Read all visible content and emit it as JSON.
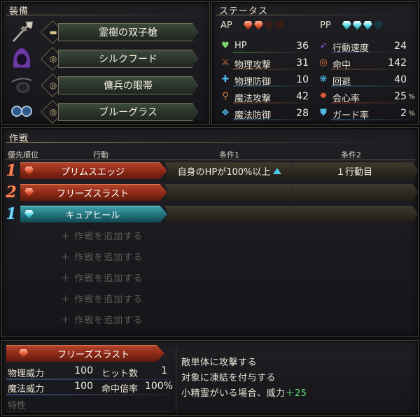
{
  "equipment": {
    "title": "装備",
    "items": [
      {
        "name": "霊樹の双子槍",
        "icon": "spear-icon",
        "slot_icon": "weapon-slot-icon"
      },
      {
        "name": "シルクフード",
        "icon": "hood-icon",
        "slot_icon": "ring-slot-icon"
      },
      {
        "name": "傭兵の眼帯",
        "icon": "eyepatch-icon",
        "slot_icon": "ring-slot-icon"
      },
      {
        "name": "ブルーグラス",
        "icon": "goggles-icon",
        "slot_icon": "ring-slot-icon"
      }
    ]
  },
  "status": {
    "title": "ステータス",
    "ap_label": "AP",
    "ap_filled": 2,
    "ap_total": 4,
    "pp_label": "PP",
    "pp_filled": 3,
    "pp_total": 4,
    "left": [
      {
        "label": "HP",
        "value": "36",
        "icon": "heart-icon",
        "color": "#7fd86a"
      },
      {
        "label": "物理攻撃",
        "value": "31",
        "icon": "sword-icon",
        "color": "#e07a3a"
      },
      {
        "label": "物理防御",
        "value": "10",
        "icon": "armor-icon",
        "color": "#4fb8e6"
      },
      {
        "label": "魔法攻撃",
        "value": "42",
        "icon": "staff-icon",
        "color": "#e0843a"
      },
      {
        "label": "魔法防御",
        "value": "28",
        "icon": "ward-icon",
        "color": "#4fb8e6"
      }
    ],
    "right": [
      {
        "label": "行動速度",
        "value": "24",
        "unit": "",
        "icon": "wing-icon",
        "color": "#8a5ad8"
      },
      {
        "label": "命中",
        "value": "142",
        "unit": "",
        "icon": "target-icon",
        "color": "#e07a3a"
      },
      {
        "label": "回避",
        "value": "40",
        "unit": "",
        "icon": "evade-icon",
        "color": "#4fb8e6"
      },
      {
        "label": "会心率",
        "value": "25",
        "unit": "%",
        "icon": "critical-icon",
        "color": "#e05a3a"
      },
      {
        "label": "ガード率",
        "value": "2",
        "unit": "%",
        "icon": "shield-icon",
        "color": "#4fb8e6"
      }
    ]
  },
  "tactics": {
    "title": "作戦",
    "headers": {
      "priority": "優先順位",
      "action": "行動",
      "cond1": "条件1",
      "cond2": "条件2"
    },
    "rows": [
      {
        "priority": "1",
        "priority_color": "red",
        "action": "プリムスエッジ",
        "gem": "red",
        "cond1": "自身のHPが100%以上",
        "cond1_marker": true,
        "cond2": "１行動目"
      },
      {
        "priority": "2",
        "priority_color": "red",
        "action": "フリーズスラスト",
        "gem": "red",
        "cond1": "",
        "cond1_marker": false,
        "cond2": ""
      },
      {
        "priority": "1",
        "priority_color": "blue",
        "action": "キュアヒール",
        "gem": "cyan",
        "cond1": "",
        "cond1_marker": false,
        "cond2": ""
      }
    ],
    "add_label": "＋ 作戦を追加する",
    "add_count": 5
  },
  "skill": {
    "name": "フリーズスラスト",
    "phys_power_label": "物理威力",
    "phys_power": "100",
    "hits_label": "ヒット数",
    "hits": "1",
    "mag_power_label": "魔法威力",
    "mag_power": "100",
    "acc_label": "命中倍率",
    "acc": "100%",
    "trait_label": "特性",
    "desc": [
      "敵単体に攻撃する",
      "対象に凍結を付与する",
      "小精霊がいる場合、威力"
    ],
    "desc_bonus": "＋25"
  }
}
